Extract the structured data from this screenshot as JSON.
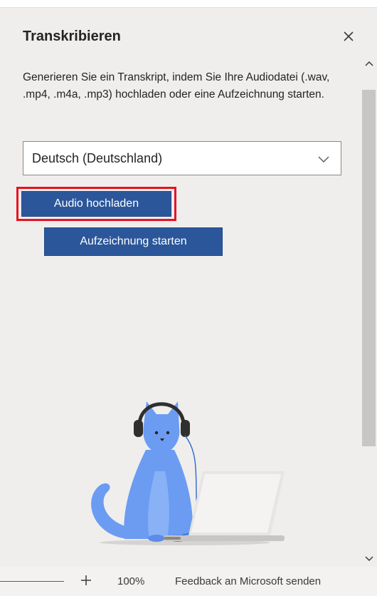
{
  "pane": {
    "title": "Transkribieren",
    "description": "Generieren Sie ein Transkript, indem Sie Ihre Audiodatei (.wav, .mp4, .m4a, .mp3) hochladen oder eine Aufzeichnung starten.",
    "language_selected": "Deutsch (Deutschland)",
    "upload_button": "Audio hochladen",
    "record_button": "Aufzeichnung starten"
  },
  "status_bar": {
    "zoom_level": "100%",
    "feedback_link": "Feedback an Microsoft senden"
  },
  "colors": {
    "primary_button": "#2b579a",
    "highlight_outline": "#e81123",
    "pane_background": "#efeeed"
  },
  "icons": {
    "close": "close-icon",
    "dropdown": "chevron-down-icon",
    "scroll_up": "chevron-up-icon",
    "scroll_down": "chevron-down-icon",
    "zoom_in": "plus-icon",
    "illustration": "cat-with-headphones-illustration"
  }
}
